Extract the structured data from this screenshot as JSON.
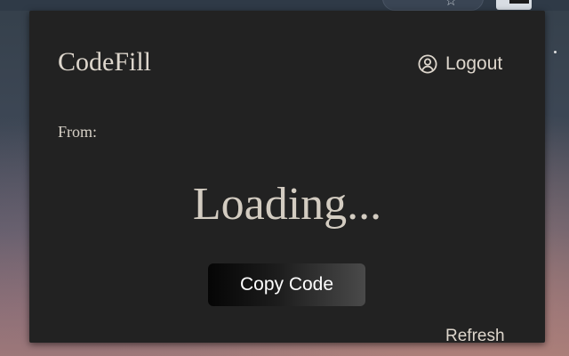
{
  "app": {
    "title": "CodeFill"
  },
  "header": {
    "logout_label": "Logout",
    "logout_icon": "user-circle-icon"
  },
  "content": {
    "from_label": "From:",
    "status_text": "Loading..."
  },
  "actions": {
    "copy_label": "Copy Code",
    "refresh_label": "Refresh"
  },
  "browser": {
    "star_icon": "star-icon"
  },
  "colors": {
    "popup_bg": "#222222",
    "text": "#ddd6cc",
    "button_text": "#ffffff"
  }
}
